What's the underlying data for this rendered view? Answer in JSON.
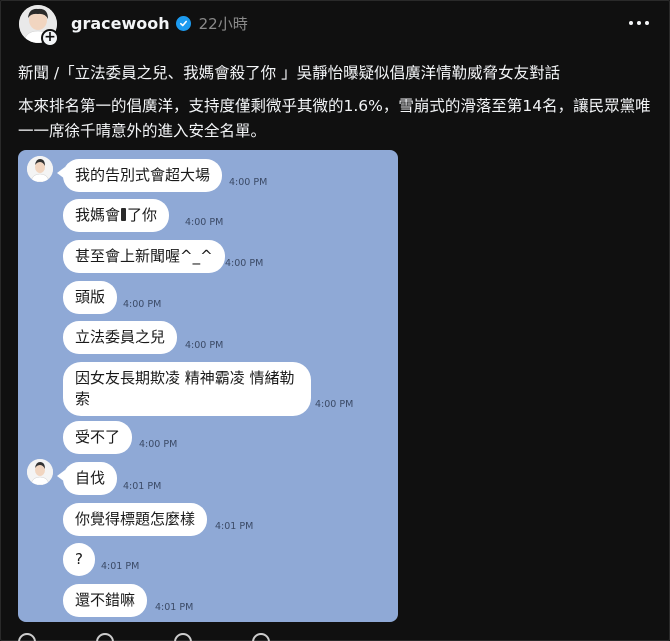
{
  "header": {
    "username": "gracewooh",
    "timestamp": "22小時"
  },
  "post": {
    "headline": "新聞 /「立法委員之兒、我媽會殺了你 」吳靜怡曝疑似倡廣洋情勒威脅女友對話",
    "body": "本來排名第一的倡廣洋，支持度僅剩微乎其微的1.6%，雪崩式的滑落至第14名，讓民眾黨唯一一席徐千晴意外的進入安全名單。"
  },
  "chat": {
    "messages": [
      {
        "text": "我的告別式會超大場",
        "time": "4:00 PM"
      },
      {
        "text_before": "我媽會",
        "text_after": "了你",
        "time": "4:00 PM"
      },
      {
        "text": "甚至會上新聞喔^_^",
        "time": "4:00 PM"
      },
      {
        "text": "頭版",
        "time": "4:00 PM"
      },
      {
        "text": "立法委員之兒",
        "time": "4:00 PM"
      },
      {
        "text_line1": "因女友長期欺凌 精神霸凌 情緒勒",
        "text_line2": "索",
        "time": "4:00 PM"
      },
      {
        "text": "受不了",
        "time": "4:00 PM"
      },
      {
        "text": "自伐",
        "time": "4:01 PM"
      },
      {
        "text": "你覺得標題怎麼樣",
        "time": "4:01 PM"
      },
      {
        "text": "?",
        "time": "4:01 PM"
      },
      {
        "text": "還不錯嘛",
        "time": "4:01 PM"
      }
    ]
  },
  "colors": {
    "background": "#101010",
    "chat_background": "#8fa9d6",
    "verified": "#1d9bf0"
  }
}
